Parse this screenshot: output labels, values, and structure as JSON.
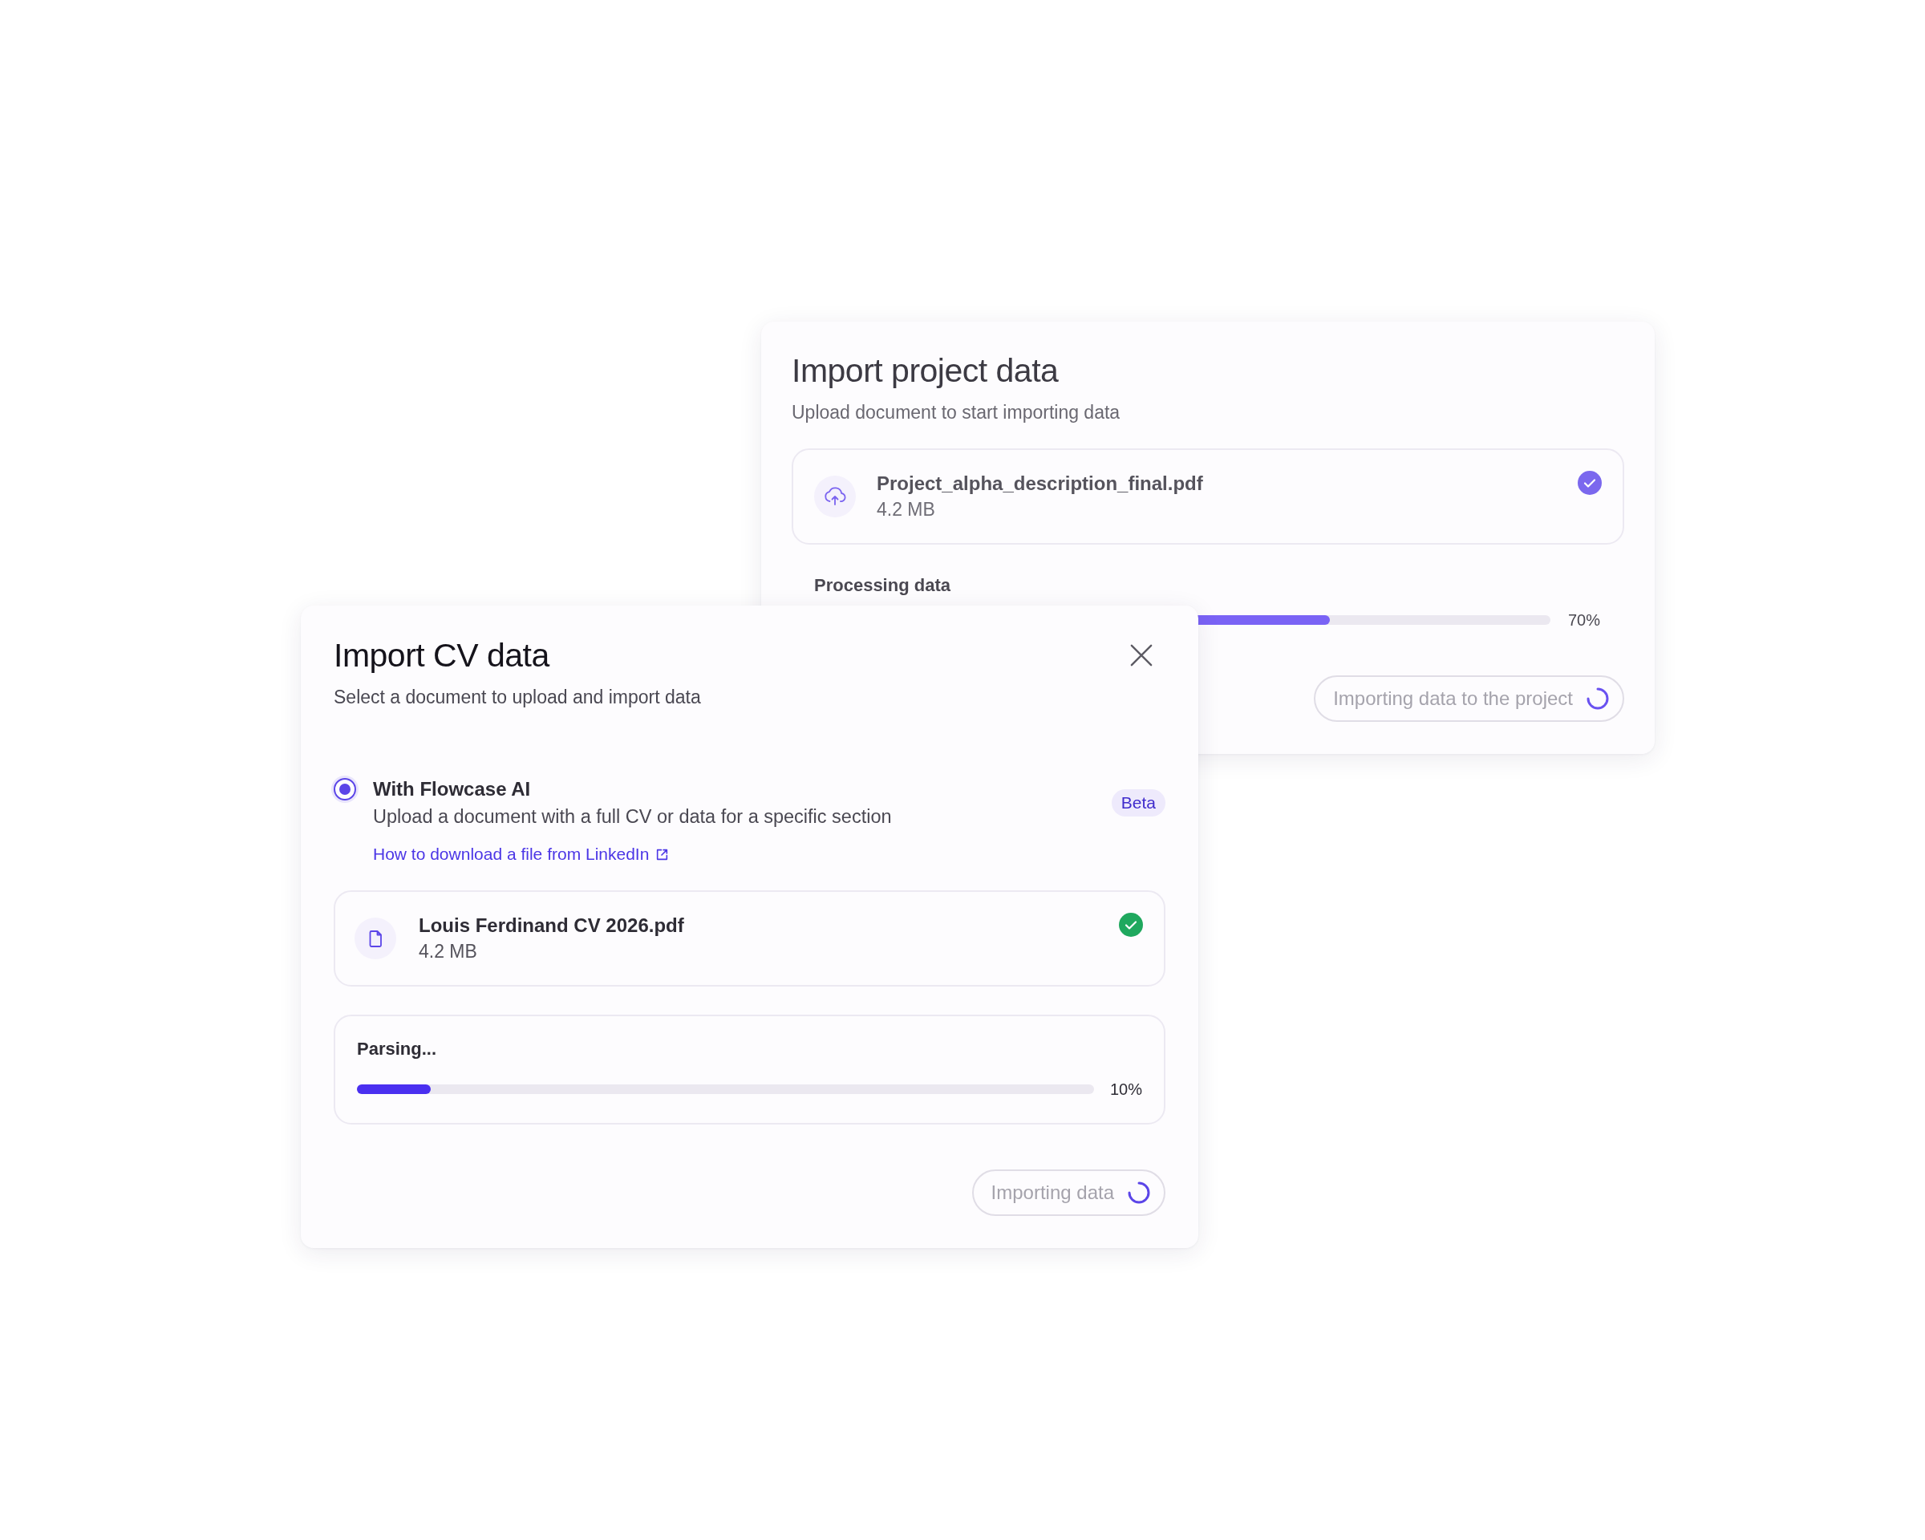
{
  "back_dialog": {
    "title": "Import project data",
    "subtitle": "Upload document to start importing data",
    "file": {
      "name": "Project_alpha_description_final.pdf",
      "size": "4.2 MB",
      "uploaded": true
    },
    "progress": {
      "label": "Processing data",
      "level": 0.7,
      "reading": "70%"
    },
    "button": {
      "label": "Importing data to the project",
      "disabled": true,
      "loading": true
    }
  },
  "front_dialog": {
    "title": "Import CV data",
    "subtitle": "Select a document to upload and import data",
    "option": {
      "label": "With Flowcase AI",
      "description": "Upload a document with a full CV or data for a specific section",
      "badge": "Beta",
      "link": "How to download a file from LinkedIn",
      "selected": true
    },
    "file": {
      "name": "Louis Ferdinand CV 2026.pdf",
      "size": "4.2 MB",
      "uploaded": true
    },
    "progress": {
      "label": "Parsing...",
      "level": 0.1,
      "reading": "10%"
    },
    "button": {
      "label": "Importing data",
      "disabled": true,
      "loading": true
    }
  }
}
